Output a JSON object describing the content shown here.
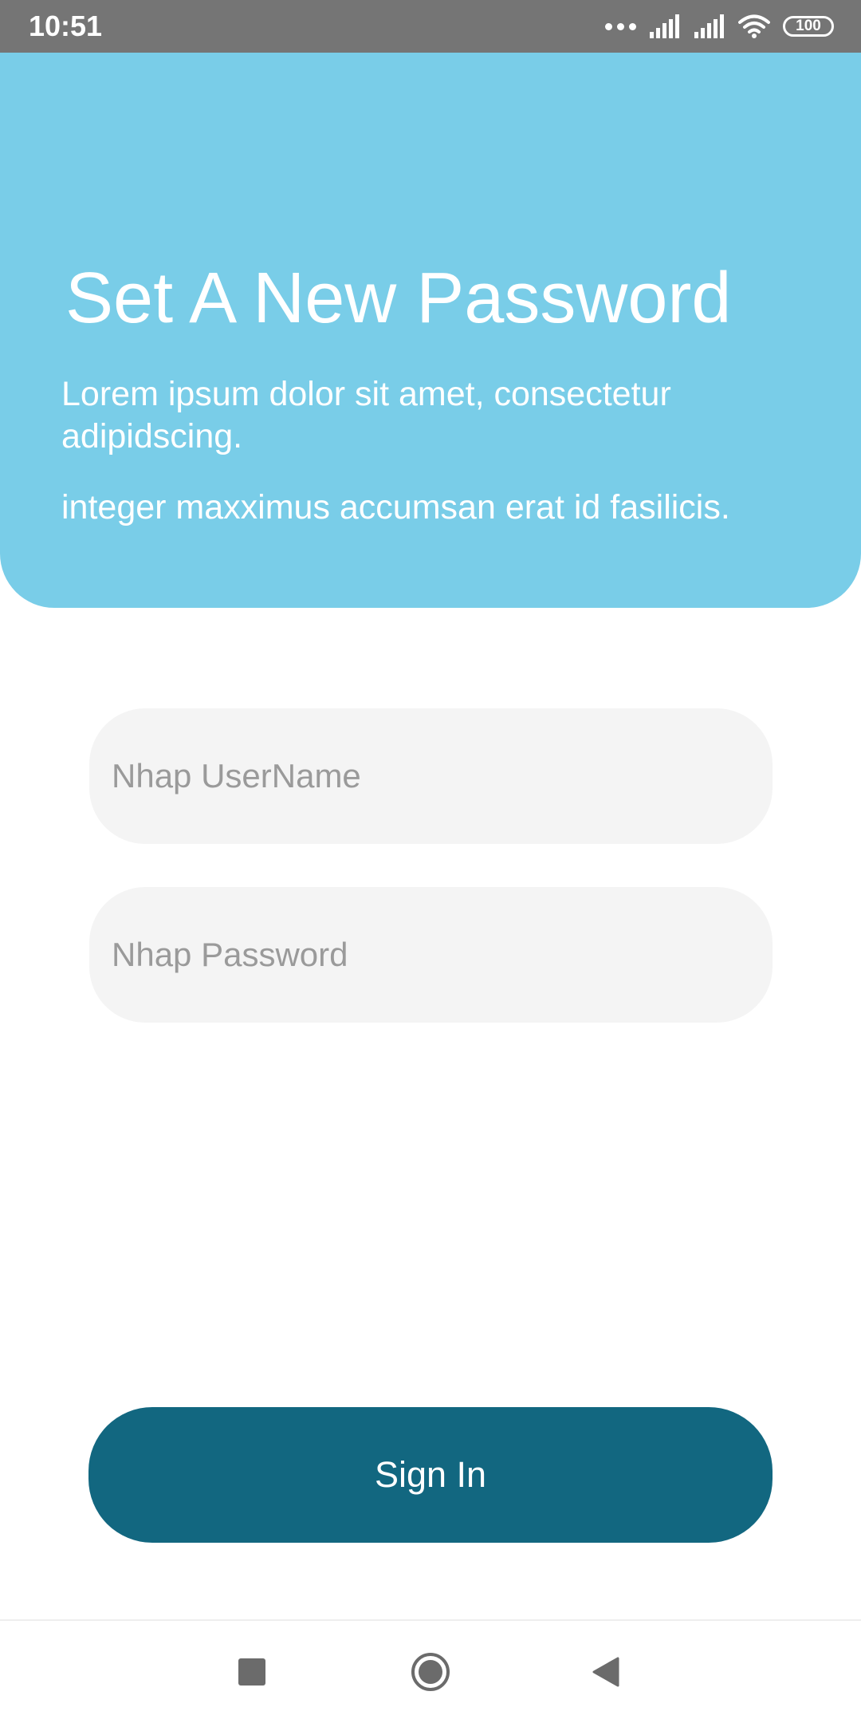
{
  "status_bar": {
    "time": "10:51",
    "battery": "100",
    "icons": [
      "more-dots-icon",
      "signal-icon",
      "signal-icon",
      "wifi-icon",
      "battery-icon"
    ]
  },
  "header": {
    "title": "Set A New Password",
    "description_1": "Lorem ipsum dolor sit amet, consectetur adipidscing.",
    "description_2": "integer maxximus accumsan erat id fasilicis.",
    "background_color": "#79cde8"
  },
  "form": {
    "username_placeholder": "Nhap UserName",
    "password_placeholder": "Nhap Password",
    "username_value": "",
    "password_value": ""
  },
  "actions": {
    "sign_in_label": "Sign In",
    "button_color": "#126780"
  },
  "nav_bar": {
    "icons": [
      "recent-apps-icon",
      "home-icon",
      "back-icon"
    ]
  }
}
